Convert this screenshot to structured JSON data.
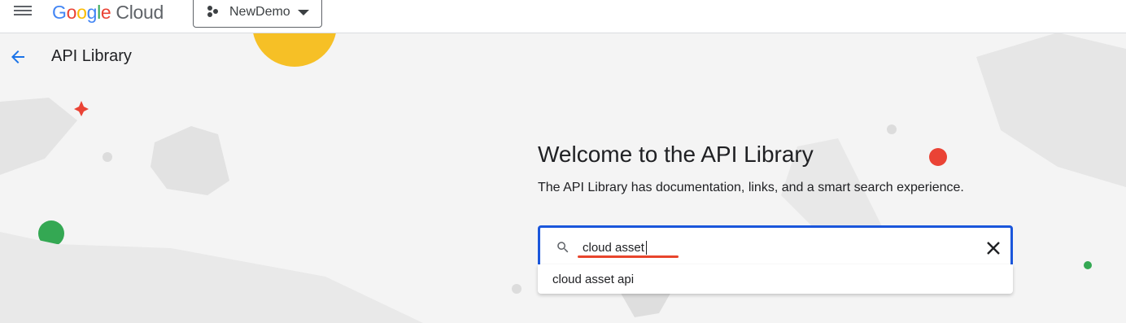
{
  "header": {
    "logo_google": [
      "G",
      "o",
      "o",
      "g",
      "l",
      "e"
    ],
    "logo_cloud": "Cloud",
    "project_name": "NewDemo"
  },
  "page": {
    "title": "API Library"
  },
  "hero": {
    "heading": "Welcome to the API Library",
    "subtitle": "The API Library has documentation, links, and a smart search experience."
  },
  "search": {
    "value": "cloud asset",
    "suggestions": [
      "cloud asset api"
    ]
  },
  "colors": {
    "accent_blue": "#1a56db",
    "spellcheck_red": "#e8452c",
    "deco_yellow": "#fbbc04",
    "deco_red": "#ea4335",
    "deco_green": "#34a853"
  }
}
